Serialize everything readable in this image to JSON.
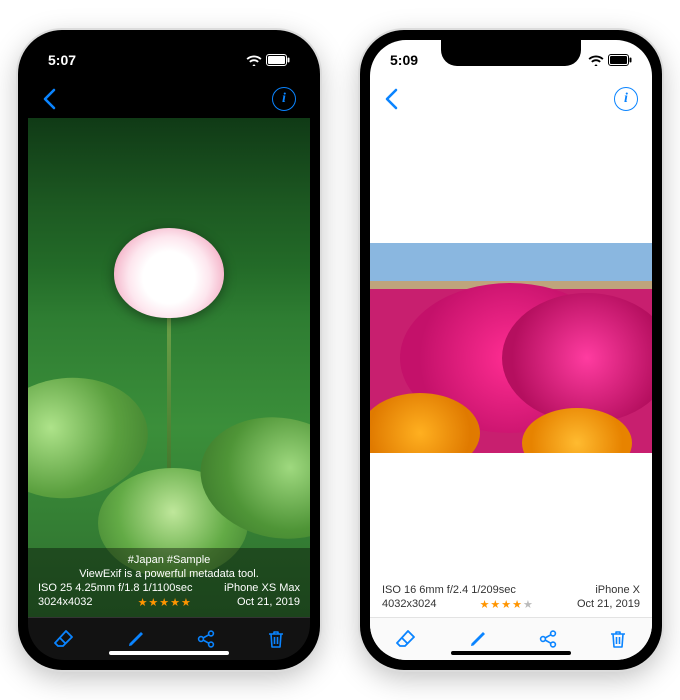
{
  "phones": [
    {
      "time": "5:07",
      "theme": "dark",
      "photo": "lotus",
      "caption_tags": "#Japan #Sample",
      "caption_text": "ViewExif is a powerful metadata tool.",
      "exif": "ISO 25  4.25mm  f/1.8  1/1100sec",
      "device": "iPhone XS Max",
      "dimensions": "3024x4032",
      "rating": 5,
      "date": "Oct 21, 2019"
    },
    {
      "time": "5:09",
      "theme": "light",
      "photo": "field",
      "exif": "ISO 16  6mm  f/2.4  1/209sec",
      "device": "iPhone X",
      "dimensions": "4032x3024",
      "rating": 4,
      "date": "Oct 21, 2019"
    }
  ],
  "icons": {
    "back": "‹",
    "info": "i",
    "eraser": "eraser-icon",
    "pencil": "pencil-icon",
    "share": "share-icon",
    "trash": "trash-icon"
  }
}
